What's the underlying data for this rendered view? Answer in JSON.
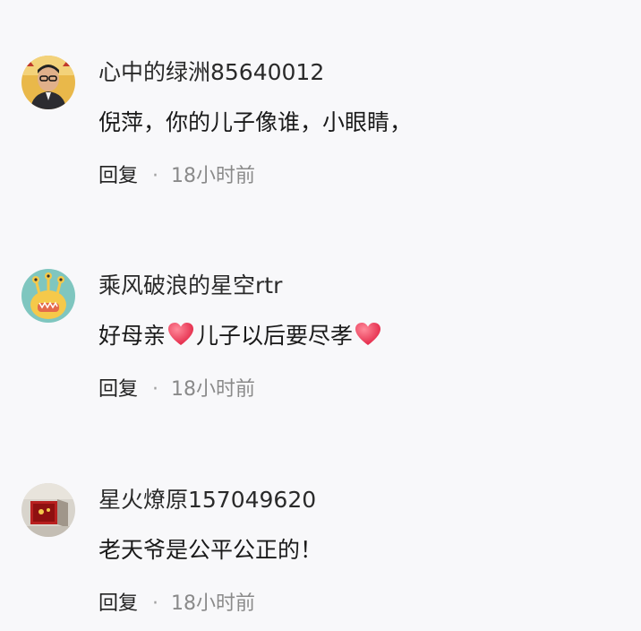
{
  "comments": [
    {
      "username": "心中的绿洲85640012",
      "segments": [
        {
          "type": "text",
          "value": "倪萍，你的儿子像谁，小眼睛，"
        }
      ],
      "reply_label": "回复",
      "separator": "·",
      "time": "18小时前",
      "avatar": "avatar-man-glasses"
    },
    {
      "username": "乘风破浪的星空rtr",
      "segments": [
        {
          "type": "text",
          "value": "好母亲"
        },
        {
          "type": "emoji",
          "value": "heart-emoji"
        },
        {
          "type": "text",
          "value": "儿子以后要尽孝"
        },
        {
          "type": "emoji",
          "value": "heart-emoji"
        }
      ],
      "reply_label": "回复",
      "separator": "·",
      "time": "18小时前",
      "avatar": "avatar-cartoon-creature"
    },
    {
      "username": "星火燎原157049620",
      "segments": [
        {
          "type": "text",
          "value": "老天爷是公平公正的！"
        }
      ],
      "reply_label": "回复",
      "separator": "·",
      "time": "18小时前",
      "avatar": "avatar-red-emblem"
    }
  ],
  "colors": {
    "background": "#f8f8fa",
    "heart": "#f0455f",
    "time": "#8a8a8a"
  }
}
